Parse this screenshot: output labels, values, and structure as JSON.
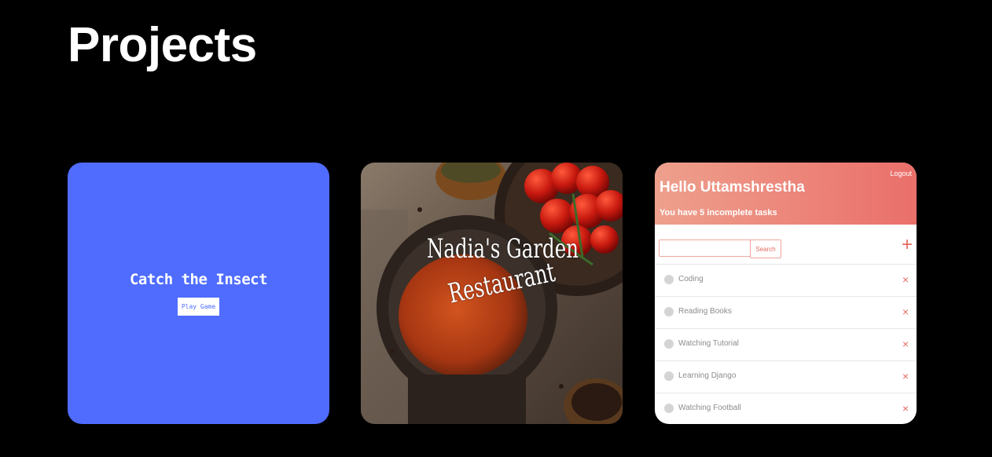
{
  "page": {
    "title": "Projects"
  },
  "projects": [
    {
      "name": "Catch the Insect",
      "button": "Play Game",
      "accent": "#4f6cff"
    },
    {
      "line1": "Nadia's Garden",
      "line2": "Restaurant"
    },
    {
      "logout": "Logout",
      "greeting": "Hello Uttamshrestha",
      "summary": "You have 5 incomplete tasks",
      "search_placeholder": "",
      "search_button": "Search",
      "add_icon": "+",
      "delete_icon": "×",
      "accent": "#ea6f6a",
      "tasks": [
        "Coding",
        "Reading Books",
        "Watching Tutorial",
        "Learning Django",
        "Watching Football"
      ]
    }
  ]
}
